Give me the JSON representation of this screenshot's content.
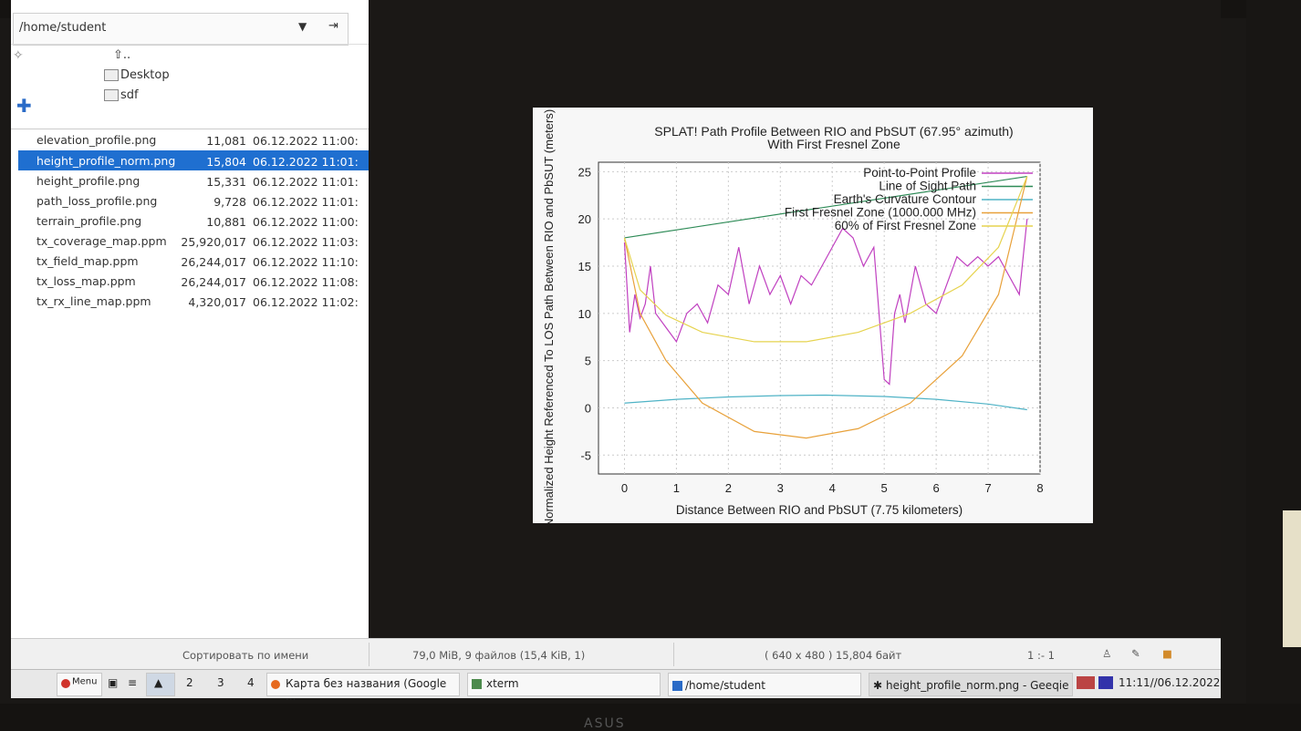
{
  "file_panel": {
    "path": "/home/student",
    "dirs": [
      "..",
      "Desktop",
      "sdf"
    ],
    "files": [
      {
        "name": "elevation_profile.png",
        "size": "11,081",
        "date": "06.12.2022 11:00:"
      },
      {
        "name": "height_profile_norm.png",
        "size": "15,804",
        "date": "06.12.2022 11:01:"
      },
      {
        "name": "height_profile.png",
        "size": "15,331",
        "date": "06.12.2022 11:01:"
      },
      {
        "name": "path_loss_profile.png",
        "size": "9,728",
        "date": "06.12.2022 11:01:"
      },
      {
        "name": "terrain_profile.png",
        "size": "10,881",
        "date": "06.12.2022 11:00:"
      },
      {
        "name": "tx_coverage_map.ppm",
        "size": "25,920,017",
        "date": "06.12.2022 11:03:"
      },
      {
        "name": "tx_field_map.ppm",
        "size": "26,244,017",
        "date": "06.12.2022 11:10:"
      },
      {
        "name": "tx_loss_map.ppm",
        "size": "26,244,017",
        "date": "06.12.2022 11:08:"
      },
      {
        "name": "tx_rx_line_map.ppm",
        "size": "4,320,017",
        "date": "06.12.2022 11:02:"
      }
    ],
    "selected_index": 1
  },
  "status": {
    "sort": "Сортировать по имени",
    "summary": "79,0 MiB, 9 файлов (15,4 KiB, 1)",
    "image_info": "( 640 x 480 ) 15,804 байт",
    "zoom": "1 :- 1"
  },
  "taskbar": {
    "menu": "Menu",
    "workspaces": [
      "2",
      "3",
      "4"
    ],
    "tasks": [
      "Карта без названия (Google ...",
      "xterm",
      "/home/student",
      "height_profile_norm.png - Geeqie"
    ],
    "clock": "11:11//06.12.2022"
  },
  "chart_data": {
    "type": "line",
    "title": "SPLAT! Path Profile Between RIO and PbSUT (67.95° azimuth)",
    "subtitle": "With First Fresnel Zone",
    "xlabel": "Distance Between RIO and PbSUT (7.75 kilometers)",
    "ylabel": "Normalized Height Referenced To LOS Path Between RIO and PbSUT (meters)",
    "xlim": [
      -0.5,
      8
    ],
    "ylim": [
      -7,
      26
    ],
    "xticks": [
      "0",
      "1",
      "2",
      "3",
      "4",
      "5",
      "6",
      "7",
      "8"
    ],
    "yticks": [
      "25",
      "20",
      "15",
      "10",
      "5",
      "0",
      "-5"
    ],
    "grid": true,
    "legend": "top-right",
    "series": [
      {
        "name": "Point-to-Point Profile",
        "color": "#c040c0",
        "x": [
          0,
          0.1,
          0.2,
          0.3,
          0.4,
          0.5,
          0.6,
          0.8,
          1.0,
          1.2,
          1.4,
          1.6,
          1.8,
          2.0,
          2.2,
          2.4,
          2.6,
          2.8,
          3.0,
          3.2,
          3.4,
          3.6,
          3.8,
          4.0,
          4.2,
          4.4,
          4.6,
          4.8,
          5.0,
          5.1,
          5.2,
          5.3,
          5.4,
          5.6,
          5.8,
          6.0,
          6.2,
          6.4,
          6.6,
          6.8,
          7.0,
          7.2,
          7.4,
          7.6,
          7.75
        ],
        "y": [
          17.5,
          8,
          12,
          9.5,
          11,
          15,
          10,
          8.5,
          7,
          10,
          11,
          9,
          13,
          12,
          17,
          11,
          15,
          12,
          14,
          11,
          14,
          13,
          15,
          17,
          19,
          18,
          15,
          17,
          3,
          2.5,
          10,
          12,
          9,
          15,
          11,
          10,
          13,
          16,
          15,
          16,
          15,
          16,
          14,
          12,
          20
        ]
      },
      {
        "name": "Line of Sight Path",
        "color": "#2e8b57",
        "x": [
          0,
          7.75
        ],
        "y": [
          18,
          24.5
        ]
      },
      {
        "name": "Earth's Curvature Contour",
        "color": "#4fb3c6",
        "x": [
          0,
          1,
          2,
          3,
          3.875,
          5,
          6,
          7,
          7.75
        ],
        "y": [
          0.5,
          0.9,
          1.15,
          1.3,
          1.35,
          1.2,
          0.9,
          0.4,
          -0.2
        ]
      },
      {
        "name": "First Fresnel Zone (1000.000 MHz)",
        "color": "#e8a13a",
        "x": [
          0,
          0.3,
          0.8,
          1.5,
          2.5,
          3.5,
          4.5,
          5.5,
          6.5,
          7.2,
          7.75
        ],
        "y": [
          18,
          10,
          5,
          0.5,
          -2.5,
          -3.2,
          -2.2,
          0.5,
          5.5,
          12,
          24.5
        ]
      },
      {
        "name": "60% of First Fresnel Zone",
        "color": "#e6d34f",
        "x": [
          0,
          0.3,
          0.8,
          1.5,
          2.5,
          3.5,
          4.5,
          5.5,
          6.5,
          7.2,
          7.75
        ],
        "y": [
          18,
          12.5,
          9.8,
          8,
          7,
          7,
          8,
          10,
          13,
          17,
          24.5
        ]
      }
    ]
  }
}
